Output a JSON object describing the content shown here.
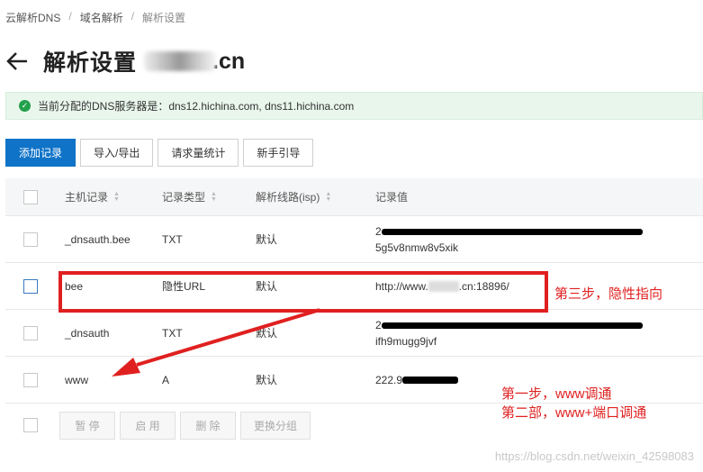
{
  "breadcrumb": {
    "items": [
      "云解析DNS",
      "域名解析",
      "解析设置"
    ],
    "sep": "/"
  },
  "header": {
    "title": "解析设置",
    "domain_suffix": ".cn"
  },
  "notice": {
    "icon": "check-circle-icon",
    "text": "当前分配的DNS服务器是：dns12.hichina.com, dns11.hichina.com"
  },
  "toolbar": {
    "add": "添加记录",
    "import_export": "导入/导出",
    "stats": "请求量统计",
    "guide": "新手引导"
  },
  "table": {
    "headers": {
      "host": "主机记录",
      "type": "记录类型",
      "line": "解析线路(isp)",
      "value": "记录值"
    },
    "rows": [
      {
        "host": "_dnsauth.bee",
        "type": "TXT",
        "line": "默认",
        "value_line1": "2",
        "value_line2": "5g5v8nmw8v5xik"
      },
      {
        "host": "bee",
        "type": "隐性URL",
        "line": "默认",
        "value_prefix": "http://www.",
        "value_suffix": ".cn:18896/"
      },
      {
        "host": "_dnsauth",
        "type": "TXT",
        "line": "默认",
        "value_line1": "2",
        "value_line2": "ifh9mugg9jvf"
      },
      {
        "host": "www",
        "type": "A",
        "line": "默认",
        "value_prefix": "222.9"
      }
    ]
  },
  "footer": {
    "pause": "暂 停",
    "enable": "启 用",
    "delete": "删 除",
    "change_group": "更换分组"
  },
  "annotations": {
    "step3": "第三步，隐性指向",
    "step1": "第一步，www调通",
    "step2": "第二部，www+端口调通"
  },
  "watermark": "https://blog.csdn.net/weixin_42598083",
  "colors": {
    "primary": "#0f73c8",
    "annotation": "#e02020",
    "success": "#22a04b"
  }
}
